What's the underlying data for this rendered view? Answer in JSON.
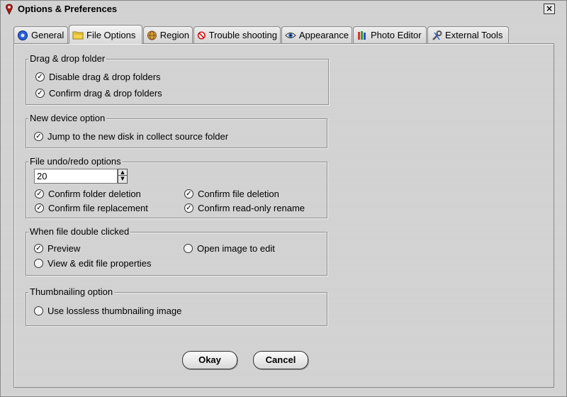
{
  "window": {
    "title": "Options & Preferences",
    "close_glyph": "×"
  },
  "tabs": [
    {
      "label": "General",
      "icon": "gear-icon"
    },
    {
      "label": "File Options",
      "icon": "folder-icon"
    },
    {
      "label": "Region",
      "icon": "globe-icon"
    },
    {
      "label": "Trouble shooting",
      "icon": "no-entry-icon"
    },
    {
      "label": "Appearance",
      "icon": "eye-icon"
    },
    {
      "label": "Photo Editor",
      "icon": "paint-icon"
    },
    {
      "label": "External Tools",
      "icon": "wrench-icon"
    }
  ],
  "groups": {
    "drag_drop": {
      "title": "Drag & drop folder",
      "options": [
        {
          "label": "Disable drag & drop folders",
          "checked": true
        },
        {
          "label": "Confirm drag & drop folders",
          "checked": true
        }
      ]
    },
    "new_device": {
      "title": "New device option",
      "options": [
        {
          "label": "Jump to the new disk in collect source folder",
          "checked": true
        }
      ]
    },
    "undo_redo": {
      "title": "File undo/redo options",
      "value": "20",
      "options": [
        {
          "label": "Confirm folder deletion",
          "checked": true
        },
        {
          "label": "Confirm file deletion",
          "checked": true
        },
        {
          "label": "Confirm file replacement",
          "checked": true
        },
        {
          "label": "Confirm read-only rename",
          "checked": true
        }
      ]
    },
    "double_click": {
      "title": "When file double clicked",
      "options": [
        {
          "label": "Preview",
          "checked": true
        },
        {
          "label": "Open image to edit",
          "checked": false
        },
        {
          "label": "View & edit file properties",
          "checked": false
        }
      ]
    },
    "thumbnail": {
      "title": "Thumbnailing option",
      "options": [
        {
          "label": "Use lossless thumbnailing image",
          "checked": false
        }
      ]
    }
  },
  "buttons": {
    "okay": "Okay",
    "cancel": "Cancel"
  },
  "glyphs": {
    "check": "✓",
    "unchecked": ""
  },
  "colors": {
    "window_bg": "#d0d0d0",
    "border": "#8a8a8a",
    "accent_blue": "#1f5fc8"
  }
}
